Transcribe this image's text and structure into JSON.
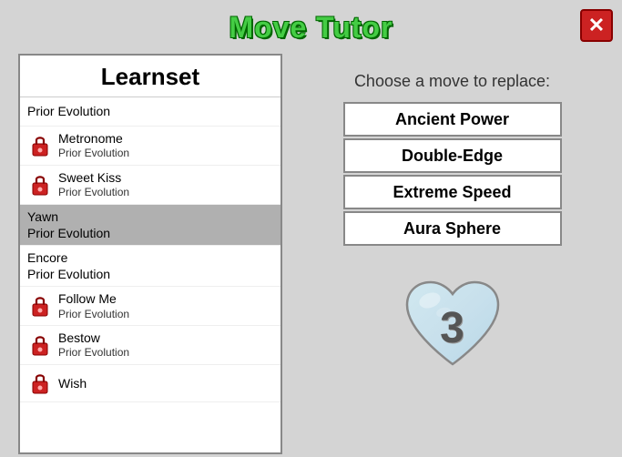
{
  "window": {
    "title": "Move Tutor",
    "close_label": "✕"
  },
  "learnset": {
    "header": "Learnset",
    "items": [
      {
        "id": "prior-evo-top",
        "type": "plain",
        "line1": "Prior Evolution",
        "line2": "",
        "selected": false,
        "locked": false
      },
      {
        "id": "metronome",
        "type": "locked",
        "line1": "Metronome",
        "line2": "Prior Evolution",
        "selected": false
      },
      {
        "id": "sweet-kiss",
        "type": "locked",
        "line1": "Sweet Kiss",
        "line2": "Prior Evolution",
        "selected": false
      },
      {
        "id": "yawn",
        "type": "plain",
        "line1": "Yawn",
        "line2": "Prior Evolution",
        "selected": true,
        "locked": false
      },
      {
        "id": "encore",
        "type": "plain",
        "line1": "Encore",
        "line2": "Prior Evolution",
        "selected": false,
        "locked": false
      },
      {
        "id": "follow-me",
        "type": "locked",
        "line1": "Follow Me",
        "line2": "Prior Evolution",
        "selected": false
      },
      {
        "id": "bestow",
        "type": "locked",
        "line1": "Bestow",
        "line2": "Prior Evolution",
        "selected": false
      },
      {
        "id": "wish",
        "type": "locked",
        "line1": "Wish",
        "line2": "",
        "selected": false
      }
    ]
  },
  "replace_panel": {
    "label": "Choose a move to replace:",
    "moves": [
      {
        "id": "ancient-power",
        "label": "Ancient Power"
      },
      {
        "id": "double-edge",
        "label": "Double-Edge"
      },
      {
        "id": "extreme-speed",
        "label": "Extreme Speed"
      },
      {
        "id": "aura-sphere",
        "label": "Aura Sphere"
      }
    ],
    "heart_number": "3"
  },
  "colors": {
    "title_green": "#44cc44",
    "lock_red": "#cc2222",
    "selected_bg": "#b0b0b0"
  }
}
